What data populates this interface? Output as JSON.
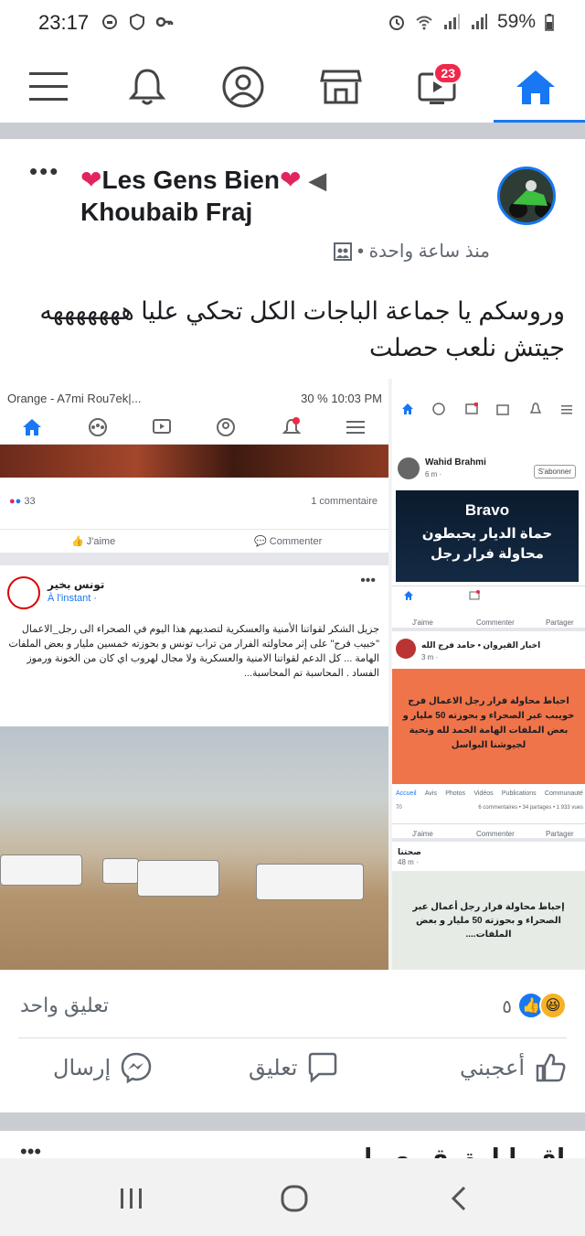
{
  "status_bar": {
    "time": "23:17",
    "battery": "59%"
  },
  "nav": {
    "items": [
      {
        "name": "menu",
        "icon": "menu-icon"
      },
      {
        "name": "notifications",
        "icon": "bell-icon"
      },
      {
        "name": "profile",
        "icon": "profile-icon"
      },
      {
        "name": "marketplace",
        "icon": "store-icon"
      },
      {
        "name": "watch",
        "icon": "video-icon",
        "badge": "23"
      },
      {
        "name": "home",
        "icon": "home-icon",
        "active": true
      }
    ],
    "accent_color": "#1877f2"
  },
  "post": {
    "group": "Les Gens Bien",
    "author": "Khoubaib Fraj",
    "time": "منذ ساعة واحدة •",
    "text_line1": "وروسكم يا جماعة الباجات الكل تحكي عليا هههههههه",
    "text_line2": "جيتش نلعب حصلت",
    "comments": "تعليق واحد",
    "reaction_count": "٥",
    "actions": {
      "like": "أعجبني",
      "comment": "تعليق",
      "send": "إرسال"
    },
    "media": {
      "left": {
        "status_carrier": "Orange - A7mi Rou7ek|...",
        "status_right": "30 % 10:03 PM",
        "reactions": "33",
        "comments": "1 commentaire",
        "like": "J'aime",
        "comment": "Commenter",
        "page_name": "تونس بخير",
        "page_time": "À l'instant · ",
        "text": "جزيل الشكر لقواتنا الأمنية والعسكرية لتصديهم هذا اليوم في الصحراء الى رجل_الاعمال \"خبيب فرج\" على إثر محاولته الفرار من تراب تونس و بحوزته خمسين مليار و بعض الملفات الهامة ... كل الدعم لقواتنا الامنية والعسكرية ولا مجال لهروب اي كان من الخونة ورموز الفساد . المحاسبة تم المحاسبة..."
      },
      "right": {
        "card1_name": "Wahid Brahmi",
        "card1_time": "6 m · ",
        "card1_follow": "S'abonner",
        "card1_line1": "Bravo",
        "card1_line2": "حماة الديار يحبطون",
        "card1_line3": "محاولة فرار رجل",
        "like": "J'aime",
        "comment": "Commenter",
        "share": "Partager",
        "card2_name": "اخبار القيروان • حامد فرج الله",
        "card2_time": "3 m · ",
        "orange_text": "احباط محاولة فرار رجل الاعمال فرج خويبب عبر الصحراء و بحوزته 50 مليار و بعض الملفات الهامة الحمد لله وتحية لجيوشنا البواسل",
        "tabs": [
          "Accueil",
          "Avis",
          "Photos",
          "Vidéos",
          "Publications",
          "Communauté"
        ],
        "reactions_small": "70",
        "shares_small": "6 commentaires • 34 partages • 1 933 vues",
        "card3_name": "صحتنا",
        "card3_time": "48 m · ",
        "light_text": "إحباط محاولة فرار رجل أعمال عبر الصحراء و بحوزته 50 مليار و بعض الملفات...."
      }
    }
  },
  "next_post": {
    "text": "اقـ باـارة ـقـ ـعـ ـا"
  },
  "android_nav": {
    "recent": "recent-apps-icon",
    "home": "home-circle-icon",
    "back": "back-icon"
  }
}
